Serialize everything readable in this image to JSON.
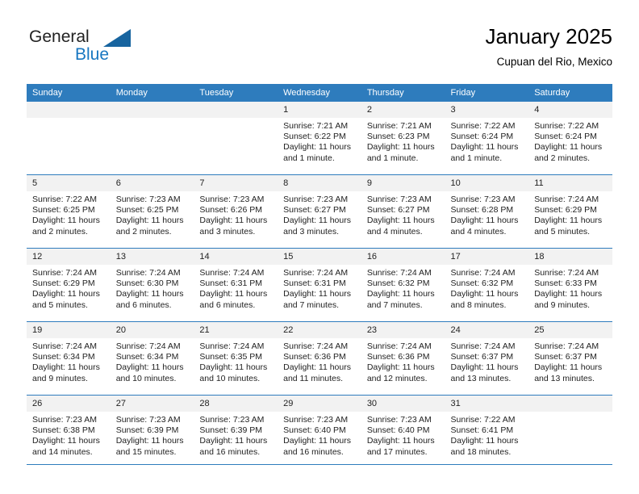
{
  "brand": {
    "name_part1": "General",
    "name_part2": "Blue",
    "triangle_color": "#17649f",
    "blue_color": "#1877c1"
  },
  "header": {
    "title": "January 2025",
    "subtitle": "Cupuan del Rio, Mexico"
  },
  "theme": {
    "header_row_bg": "#2e7cbd",
    "daynum_bg": "#f2f2f2",
    "grid_line": "#2e7cbd",
    "text": "#222222"
  },
  "weekday_headers": [
    "Sunday",
    "Monday",
    "Tuesday",
    "Wednesday",
    "Thursday",
    "Friday",
    "Saturday"
  ],
  "labels": {
    "sunrise_prefix": "Sunrise: ",
    "sunset_prefix": "Sunset: ",
    "daylight_prefix": "Daylight: "
  },
  "weeks": [
    [
      {
        "day": "",
        "sunrise": "",
        "sunset": "",
        "daylight_line1": "",
        "daylight_line2": ""
      },
      {
        "day": "",
        "sunrise": "",
        "sunset": "",
        "daylight_line1": "",
        "daylight_line2": ""
      },
      {
        "day": "",
        "sunrise": "",
        "sunset": "",
        "daylight_line1": "",
        "daylight_line2": ""
      },
      {
        "day": "1",
        "sunrise": "Sunrise: 7:21 AM",
        "sunset": "Sunset: 6:22 PM",
        "daylight_line1": "Daylight: 11 hours",
        "daylight_line2": "and 1 minute."
      },
      {
        "day": "2",
        "sunrise": "Sunrise: 7:21 AM",
        "sunset": "Sunset: 6:23 PM",
        "daylight_line1": "Daylight: 11 hours",
        "daylight_line2": "and 1 minute."
      },
      {
        "day": "3",
        "sunrise": "Sunrise: 7:22 AM",
        "sunset": "Sunset: 6:24 PM",
        "daylight_line1": "Daylight: 11 hours",
        "daylight_line2": "and 1 minute."
      },
      {
        "day": "4",
        "sunrise": "Sunrise: 7:22 AM",
        "sunset": "Sunset: 6:24 PM",
        "daylight_line1": "Daylight: 11 hours",
        "daylight_line2": "and 2 minutes."
      }
    ],
    [
      {
        "day": "5",
        "sunrise": "Sunrise: 7:22 AM",
        "sunset": "Sunset: 6:25 PM",
        "daylight_line1": "Daylight: 11 hours",
        "daylight_line2": "and 2 minutes."
      },
      {
        "day": "6",
        "sunrise": "Sunrise: 7:23 AM",
        "sunset": "Sunset: 6:25 PM",
        "daylight_line1": "Daylight: 11 hours",
        "daylight_line2": "and 2 minutes."
      },
      {
        "day": "7",
        "sunrise": "Sunrise: 7:23 AM",
        "sunset": "Sunset: 6:26 PM",
        "daylight_line1": "Daylight: 11 hours",
        "daylight_line2": "and 3 minutes."
      },
      {
        "day": "8",
        "sunrise": "Sunrise: 7:23 AM",
        "sunset": "Sunset: 6:27 PM",
        "daylight_line1": "Daylight: 11 hours",
        "daylight_line2": "and 3 minutes."
      },
      {
        "day": "9",
        "sunrise": "Sunrise: 7:23 AM",
        "sunset": "Sunset: 6:27 PM",
        "daylight_line1": "Daylight: 11 hours",
        "daylight_line2": "and 4 minutes."
      },
      {
        "day": "10",
        "sunrise": "Sunrise: 7:23 AM",
        "sunset": "Sunset: 6:28 PM",
        "daylight_line1": "Daylight: 11 hours",
        "daylight_line2": "and 4 minutes."
      },
      {
        "day": "11",
        "sunrise": "Sunrise: 7:24 AM",
        "sunset": "Sunset: 6:29 PM",
        "daylight_line1": "Daylight: 11 hours",
        "daylight_line2": "and 5 minutes."
      }
    ],
    [
      {
        "day": "12",
        "sunrise": "Sunrise: 7:24 AM",
        "sunset": "Sunset: 6:29 PM",
        "daylight_line1": "Daylight: 11 hours",
        "daylight_line2": "and 5 minutes."
      },
      {
        "day": "13",
        "sunrise": "Sunrise: 7:24 AM",
        "sunset": "Sunset: 6:30 PM",
        "daylight_line1": "Daylight: 11 hours",
        "daylight_line2": "and 6 minutes."
      },
      {
        "day": "14",
        "sunrise": "Sunrise: 7:24 AM",
        "sunset": "Sunset: 6:31 PM",
        "daylight_line1": "Daylight: 11 hours",
        "daylight_line2": "and 6 minutes."
      },
      {
        "day": "15",
        "sunrise": "Sunrise: 7:24 AM",
        "sunset": "Sunset: 6:31 PM",
        "daylight_line1": "Daylight: 11 hours",
        "daylight_line2": "and 7 minutes."
      },
      {
        "day": "16",
        "sunrise": "Sunrise: 7:24 AM",
        "sunset": "Sunset: 6:32 PM",
        "daylight_line1": "Daylight: 11 hours",
        "daylight_line2": "and 7 minutes."
      },
      {
        "day": "17",
        "sunrise": "Sunrise: 7:24 AM",
        "sunset": "Sunset: 6:32 PM",
        "daylight_line1": "Daylight: 11 hours",
        "daylight_line2": "and 8 minutes."
      },
      {
        "day": "18",
        "sunrise": "Sunrise: 7:24 AM",
        "sunset": "Sunset: 6:33 PM",
        "daylight_line1": "Daylight: 11 hours",
        "daylight_line2": "and 9 minutes."
      }
    ],
    [
      {
        "day": "19",
        "sunrise": "Sunrise: 7:24 AM",
        "sunset": "Sunset: 6:34 PM",
        "daylight_line1": "Daylight: 11 hours",
        "daylight_line2": "and 9 minutes."
      },
      {
        "day": "20",
        "sunrise": "Sunrise: 7:24 AM",
        "sunset": "Sunset: 6:34 PM",
        "daylight_line1": "Daylight: 11 hours",
        "daylight_line2": "and 10 minutes."
      },
      {
        "day": "21",
        "sunrise": "Sunrise: 7:24 AM",
        "sunset": "Sunset: 6:35 PM",
        "daylight_line1": "Daylight: 11 hours",
        "daylight_line2": "and 10 minutes."
      },
      {
        "day": "22",
        "sunrise": "Sunrise: 7:24 AM",
        "sunset": "Sunset: 6:36 PM",
        "daylight_line1": "Daylight: 11 hours",
        "daylight_line2": "and 11 minutes."
      },
      {
        "day": "23",
        "sunrise": "Sunrise: 7:24 AM",
        "sunset": "Sunset: 6:36 PM",
        "daylight_line1": "Daylight: 11 hours",
        "daylight_line2": "and 12 minutes."
      },
      {
        "day": "24",
        "sunrise": "Sunrise: 7:24 AM",
        "sunset": "Sunset: 6:37 PM",
        "daylight_line1": "Daylight: 11 hours",
        "daylight_line2": "and 13 minutes."
      },
      {
        "day": "25",
        "sunrise": "Sunrise: 7:24 AM",
        "sunset": "Sunset: 6:37 PM",
        "daylight_line1": "Daylight: 11 hours",
        "daylight_line2": "and 13 minutes."
      }
    ],
    [
      {
        "day": "26",
        "sunrise": "Sunrise: 7:23 AM",
        "sunset": "Sunset: 6:38 PM",
        "daylight_line1": "Daylight: 11 hours",
        "daylight_line2": "and 14 minutes."
      },
      {
        "day": "27",
        "sunrise": "Sunrise: 7:23 AM",
        "sunset": "Sunset: 6:39 PM",
        "daylight_line1": "Daylight: 11 hours",
        "daylight_line2": "and 15 minutes."
      },
      {
        "day": "28",
        "sunrise": "Sunrise: 7:23 AM",
        "sunset": "Sunset: 6:39 PM",
        "daylight_line1": "Daylight: 11 hours",
        "daylight_line2": "and 16 minutes."
      },
      {
        "day": "29",
        "sunrise": "Sunrise: 7:23 AM",
        "sunset": "Sunset: 6:40 PM",
        "daylight_line1": "Daylight: 11 hours",
        "daylight_line2": "and 16 minutes."
      },
      {
        "day": "30",
        "sunrise": "Sunrise: 7:23 AM",
        "sunset": "Sunset: 6:40 PM",
        "daylight_line1": "Daylight: 11 hours",
        "daylight_line2": "and 17 minutes."
      },
      {
        "day": "31",
        "sunrise": "Sunrise: 7:22 AM",
        "sunset": "Sunset: 6:41 PM",
        "daylight_line1": "Daylight: 11 hours",
        "daylight_line2": "and 18 minutes."
      },
      {
        "day": "",
        "sunrise": "",
        "sunset": "",
        "daylight_line1": "",
        "daylight_line2": ""
      }
    ]
  ]
}
